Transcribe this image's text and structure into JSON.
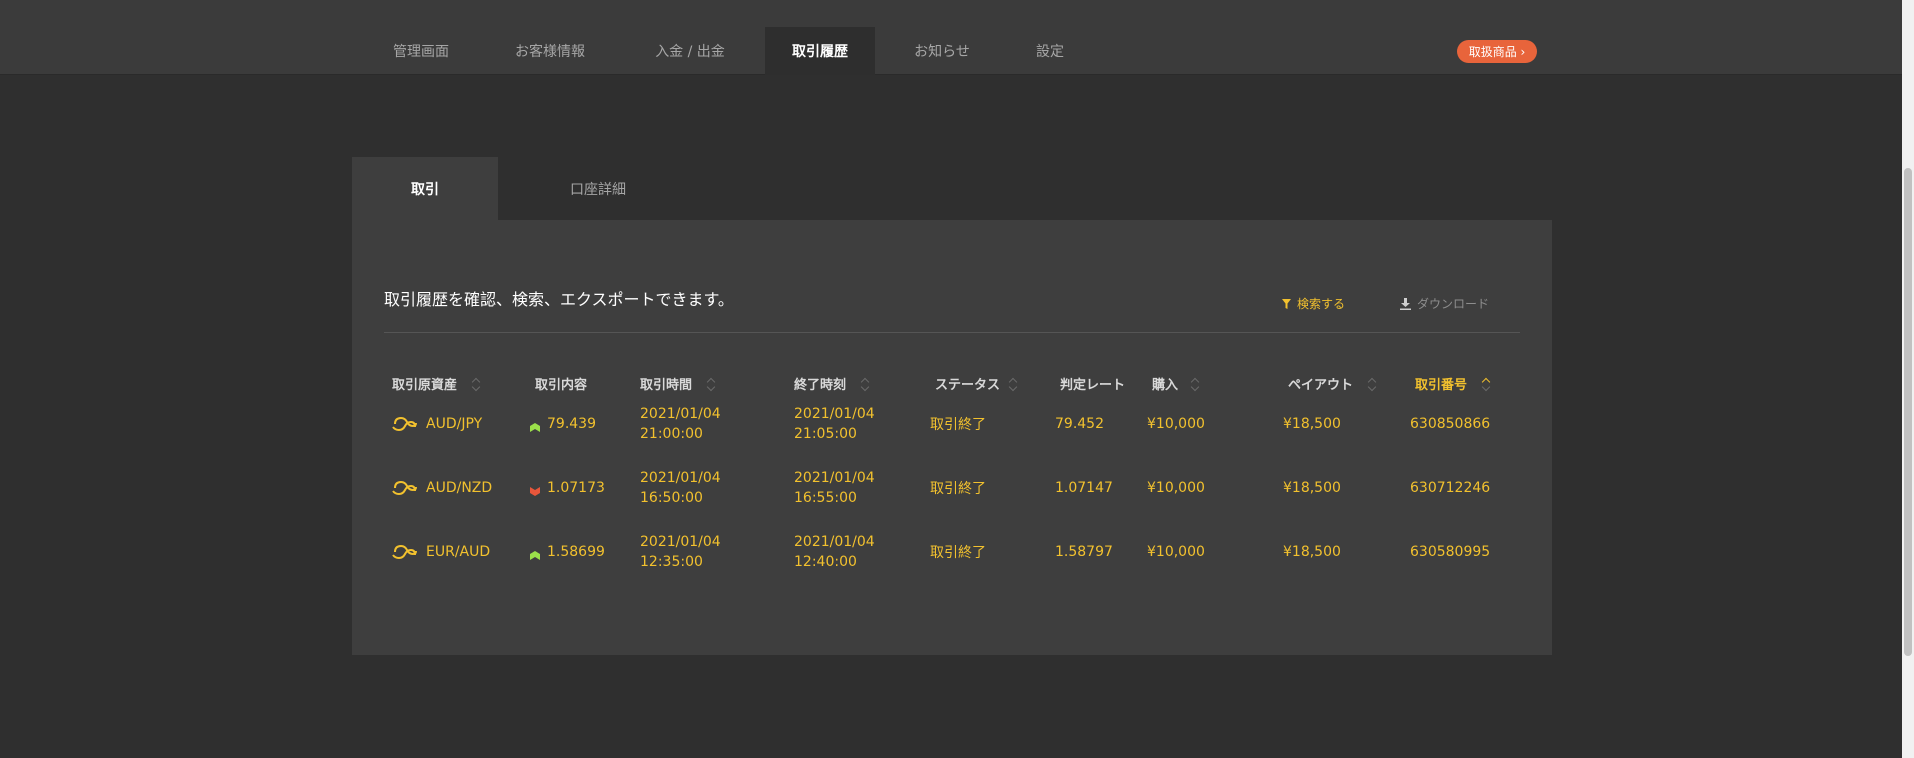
{
  "nav": {
    "tabs": [
      {
        "label": "管理画面"
      },
      {
        "label": "お客様情報"
      },
      {
        "label": "入金 / 出金"
      },
      {
        "label": "取引履歴"
      },
      {
        "label": "お知らせ"
      },
      {
        "label": "設定"
      }
    ],
    "active_tab": "取引履歴",
    "promo_label": "取扱商品 ›"
  },
  "subtabs": [
    {
      "label": "取引"
    },
    {
      "label": "口座詳細"
    }
  ],
  "panel": {
    "intro": "取引履歴を確認、検索、エクスポートできます。",
    "search_label": "検索する",
    "download_label": "ダウンロード"
  },
  "table": {
    "headers": [
      "取引原資産",
      "取引内容",
      "取引時間",
      "終了時刻",
      "ステータス",
      "判定レート",
      "購入",
      "ペイアウト",
      "取引番号"
    ],
    "rows": [
      {
        "asset": "AUD/JPY",
        "direction": "up",
        "entry": "79.439",
        "start_date": "2021/01/04",
        "start_time": "21:00:00",
        "end_date": "2021/01/04",
        "end_time": "21:05:00",
        "status": "取引終了",
        "rate": "79.452",
        "purchase": "¥10,000",
        "payout": "¥18,500",
        "trade_no": "630850866"
      },
      {
        "asset": "AUD/NZD",
        "direction": "down",
        "entry": "1.07173",
        "start_date": "2021/01/04",
        "start_time": "16:50:00",
        "end_date": "2021/01/04",
        "end_time": "16:55:00",
        "status": "取引終了",
        "rate": "1.07147",
        "purchase": "¥10,000",
        "payout": "¥18,500",
        "trade_no": "630712246"
      },
      {
        "asset": "EUR/AUD",
        "direction": "up",
        "entry": "1.58699",
        "start_date": "2021/01/04",
        "start_time": "12:35:00",
        "end_date": "2021/01/04",
        "end_time": "12:40:00",
        "status": "取引終了",
        "rate": "1.58797",
        "purchase": "¥10,000",
        "payout": "¥18,500",
        "trade_no": "630580995"
      }
    ]
  },
  "colors": {
    "accent": "#f2c12e",
    "up": "#9be04a",
    "down": "#e8563b",
    "promo": "#e8643b"
  },
  "icons": {
    "asset": "currency-pair-icon",
    "search": "filter-icon",
    "download": "download-icon"
  }
}
